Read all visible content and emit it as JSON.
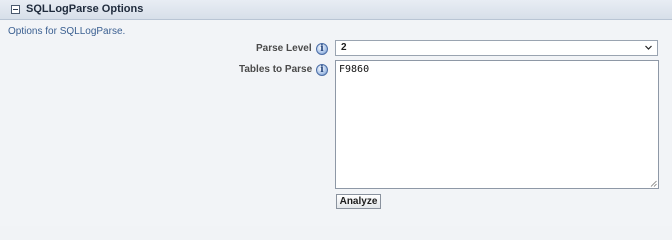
{
  "panel": {
    "title": "SQLLogParse Options",
    "description": "Options for SQLLogParse."
  },
  "fields": {
    "parse_level": {
      "label": "Parse Level",
      "value": "2"
    },
    "tables_to_parse": {
      "label": "Tables to Parse",
      "value": "F9860"
    }
  },
  "actions": {
    "analyze_label": "Analyze"
  },
  "icons": {
    "collapse": "collapse-icon",
    "info": "info-icon",
    "dropdown": "chevron-down-icon",
    "resize": "resize-grip-icon"
  }
}
